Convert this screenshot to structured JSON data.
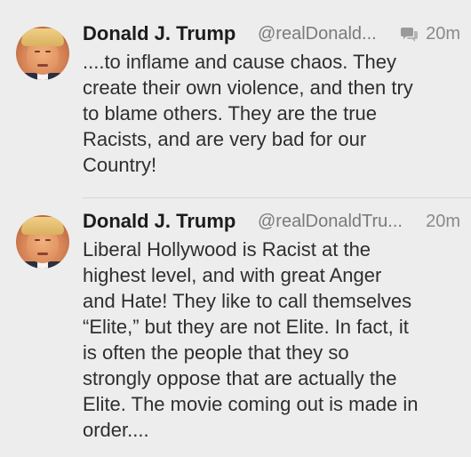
{
  "tweets": [
    {
      "name": "Donald J. Trump",
      "handle": "@realDonald...",
      "time": "20m",
      "has_conversation_icon": true,
      "text": "....to inflame and cause chaos. They\ncreate their own violence, and then try\nto blame others. They are the true\nRacists, and are very bad for our\nCountry!"
    },
    {
      "name": "Donald J. Trump",
      "handle": "@realDonaldTru...",
      "time": "20m",
      "has_conversation_icon": false,
      "text": "Liberal Hollywood is Racist at the\nhighest level, and with great Anger\nand Hate! They like to call themselves\n“Elite,” but they are not Elite. In fact, it\nis often the people that they so\nstrongly oppose that are actually the\nElite. The movie coming out is made in\norder...."
    }
  ],
  "colors": {
    "background": "#ededed",
    "name": "#1c1c1c",
    "handle": "#7a7a7a",
    "divider": "#d6d6d6"
  },
  "icons": {
    "conversation": "conversation-icon"
  }
}
